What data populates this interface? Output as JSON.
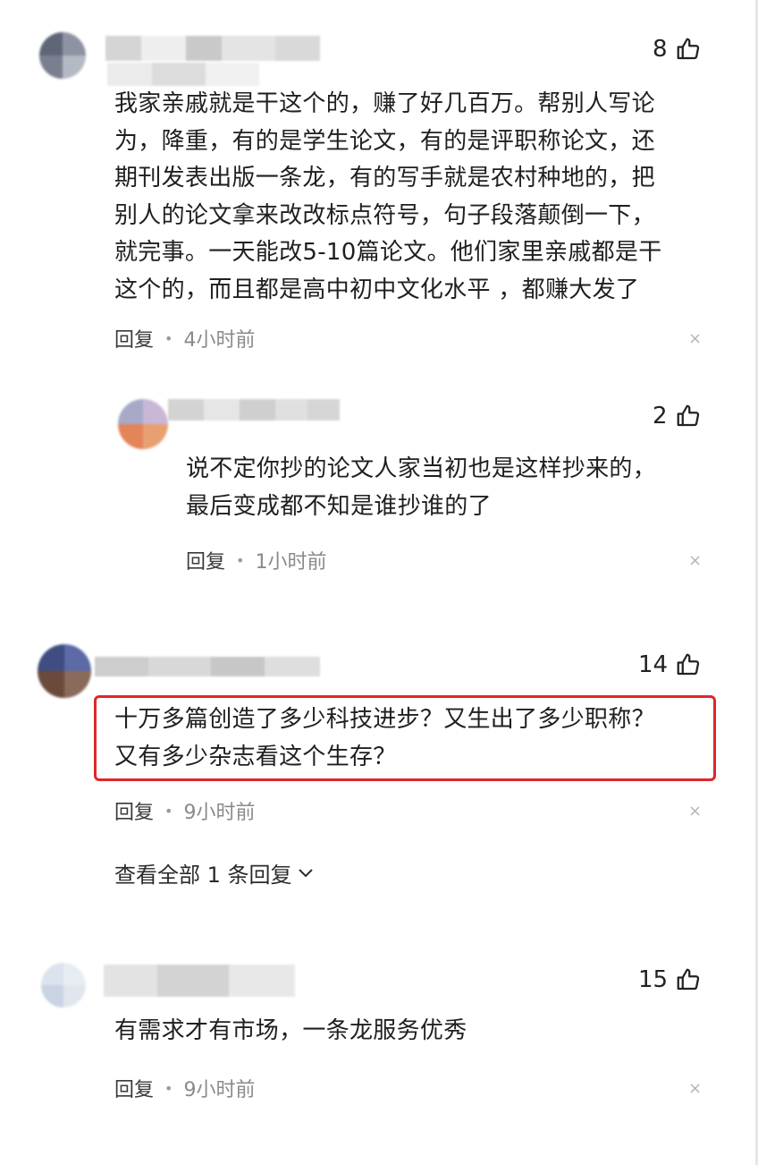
{
  "comments": [
    {
      "likes": "8",
      "lines": [
        "我家亲戚就是干这个的，赚了好几百万。帮别人写论",
        "为，降重，有的是学生论文，有的是评职称论文，还",
        "期刊发表出版一条龙，有的写手就是农村种地的，把",
        "别人的论文拿来改改标点符号，句子段落颠倒一下，",
        "就完事。一天能改5-10篇论文。他们家里亲戚都是干",
        "这个的，而且都是高中初中文化水平 ，都赚大发了"
      ],
      "reply_label": "回复",
      "time": "4小时前"
    },
    {
      "likes": "2",
      "lines": [
        "说不定你抄的论文人家当初也是这样抄来的，",
        "最后变成都不知是谁抄谁的了"
      ],
      "reply_label": "回复",
      "time": "1小时前"
    },
    {
      "likes": "14",
      "lines": [
        "十万多篇创造了多少科技进步？又生出了多少职称？",
        "又有多少杂志看这个生存？"
      ],
      "reply_label": "回复",
      "time": "9小时前",
      "view_all": "查看全部 1 条回复"
    },
    {
      "likes": "15",
      "lines": [
        "有需求才有市场，一条龙服务优秀"
      ],
      "reply_label": "回复",
      "time": "9小时前"
    }
  ],
  "colors": {
    "highlight_border": "#e0262a",
    "meta_time": "#8a8a8a",
    "text": "#1f1f1f"
  },
  "icons": {
    "like": "thumbs-up-outline-icon",
    "close": "close-icon",
    "expand": "chevron-down-icon"
  }
}
